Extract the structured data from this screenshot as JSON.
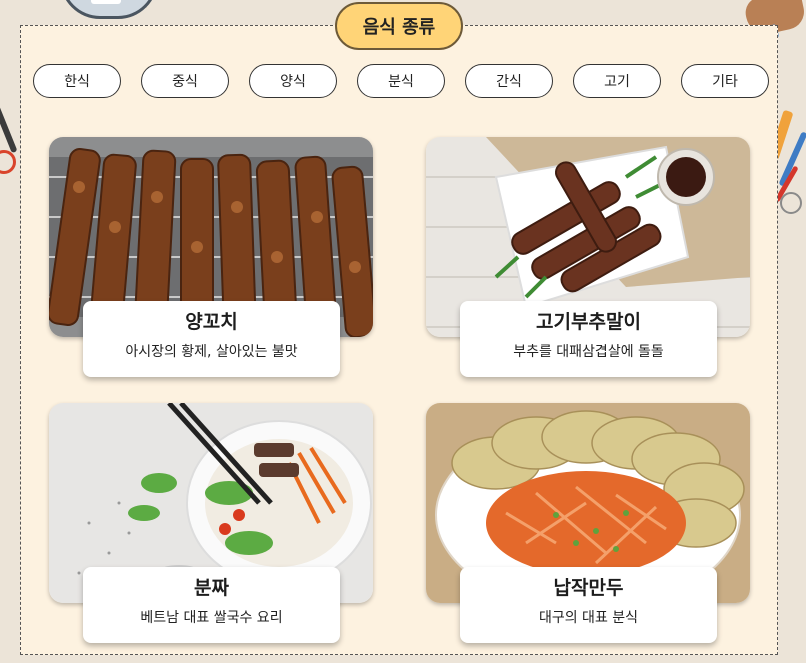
{
  "header": {
    "title": "음식 종류"
  },
  "categories": [
    "한식",
    "중식",
    "양식",
    "분식",
    "간식",
    "고기",
    "기타"
  ],
  "foods": [
    {
      "name": "양꼬치",
      "desc": "아시장의 황제, 살아있는 불맛"
    },
    {
      "name": "고기부추말이",
      "desc": "부추를 대패삼겹살에 돌돌"
    },
    {
      "name": "분짜",
      "desc": "베트남 대표 쌀국수 요리"
    },
    {
      "name": "납작만두",
      "desc": "대구의 대표 분식"
    }
  ]
}
